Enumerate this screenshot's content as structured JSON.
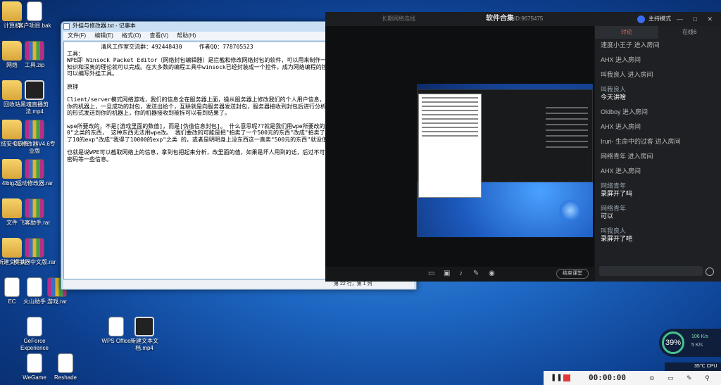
{
  "desktop_icons": [
    {
      "label": "计算机",
      "kind": "folder"
    },
    {
      "label": "客户项目.bak",
      "kind": "doc"
    },
    {
      "label": "网络",
      "kind": "folder"
    },
    {
      "label": "工具.zip",
      "kind": "rar"
    },
    {
      "label": "回收站",
      "kind": "folder"
    },
    {
      "label": "黑魂直播剪法.mp4",
      "kind": "video"
    },
    {
      "label": "火绒安全软件",
      "kind": "folder"
    },
    {
      "label": "CE修改器V4.6专业版",
      "kind": "rar"
    },
    {
      "label": "4lbtg2...",
      "kind": "folder"
    },
    {
      "label": "运动修改器.rar",
      "kind": "rar"
    },
    {
      "label": "文件",
      "kind": "folder"
    },
    {
      "label": "飞客助手.rar",
      "kind": "rar"
    },
    {
      "label": "新建文件夹",
      "kind": "folder"
    },
    {
      "label": "模拟器中文版.rar",
      "kind": "rar"
    },
    {
      "label": "EC",
      "kind": "doc"
    },
    {
      "label": "火山助手",
      "kind": "doc"
    },
    {
      "label": "游戏.rar",
      "kind": "rar"
    },
    {
      "label": "GeForce Experience",
      "kind": "doc"
    },
    {
      "label": "WPS Office",
      "kind": "doc"
    },
    {
      "label": "新建文本文档.mp4",
      "kind": "video"
    },
    {
      "label": "WeGame",
      "kind": "doc"
    },
    {
      "label": "Reshade",
      "kind": "doc"
    }
  ],
  "notepad": {
    "title": "外挂与修改器.txt - 记事本",
    "controls": {
      "min": "–",
      "max": "□",
      "close": "✕"
    },
    "menu": [
      "文件(F)",
      "编辑(E)",
      "格式(O)",
      "查看(V)",
      "帮助(H)"
    ],
    "header_line": "          清风工作室交流群：492448430     作者QQ：778705523",
    "paragraphs": [
      "工具：",
      "WPE即 Winsock Packet Editor（网络封包编辑器）是拦截和修改网络封包的软件，可以用来制作一些游戏外挂软件，不需要专业的知识和深奥的理论就可以完成。在大多数的编程工具中winsock已经封装成一个控件，成为网络编程的控件，利用这个控件，编程工具就可以编写外挂工具。",
      "原理",
      "Client/server模式网络游戏，我们的信息全在服务器上面，操从服务器上修改我们的个人用户信息，可能性为将不其微。客户端发送在你的机器上，一旦成功的封包，发送出给个，互联就是向服务器发送封包，服务器接收到封包后进行分析，然后返回结果，结果也是以封包的形式发送到你的机器上，你的机器接收到被拆可以看到结果了。",
      "wpe所要改的，不是[游戏里面的数值]，而是[伪造信息封包]。 什么意思呢??就是我们用wpe所要改的，并不是\"生命力由100变成10000\"之类的东西， 这种东西无法用wpe改。 我们要改的可能是把\"拍卖了一个500元的东西\"改成\"拍卖了一个50000元的东西\"或把\"我得了10的exp\"改成\"我得了10000的exp\"之类 的，或者是明明身上没东西这一直卖\"500元的东西\"就没值物这一直打10的exp\"。",
      "也就是说WPE可以截取网络上的信息，拿到包把起来分析，改里面的值，如果是坏人用到的话，后过不可想像，更可怕的是用它来截取网络密码等一些信息。"
    ],
    "status": "第 22 行，第 1 列"
  },
  "live": {
    "top_dim": "长期网络连线",
    "title": "软件合集",
    "room_id": "ID:9675475",
    "mode_label": "主持模式",
    "toolbar": {
      "end_button": "结束课堂"
    },
    "tabs": [
      "讨论",
      "在线6"
    ],
    "messages": [
      {
        "name": "",
        "text": "",
        "system": "速度小王子 进入房间"
      },
      {
        "name": "",
        "text": "",
        "system": "AHX 进入房间"
      },
      {
        "name": "",
        "text": "",
        "system": "叫我良人 进入房间"
      },
      {
        "name": "叫我良人",
        "text": "今天讲啥",
        "system": ""
      },
      {
        "name": "",
        "text": "",
        "system": "Oldboy 进入房间"
      },
      {
        "name": "",
        "text": "",
        "system": "AHX 进入房间"
      },
      {
        "name": "",
        "text": "",
        "system": "Iruri- 生命中的过客 进入房间"
      },
      {
        "name": "",
        "text": "",
        "system": "网络青年 进入房间"
      },
      {
        "name": "",
        "text": "",
        "system": "AHX 进入房间"
      },
      {
        "name": "网络青年",
        "text": "录屏开了吗",
        "system": ""
      },
      {
        "name": "网络青年",
        "text": "可以",
        "system": ""
      },
      {
        "name": "叫我良人",
        "text": "录屏开了吧",
        "system": ""
      }
    ]
  },
  "net_widget": {
    "percent": "39%",
    "up": "106 K/s",
    "down": "5 K/s"
  },
  "cpu_widget": {
    "text": "35℃ CPU"
  },
  "recorder": {
    "time": "00:00:00"
  }
}
